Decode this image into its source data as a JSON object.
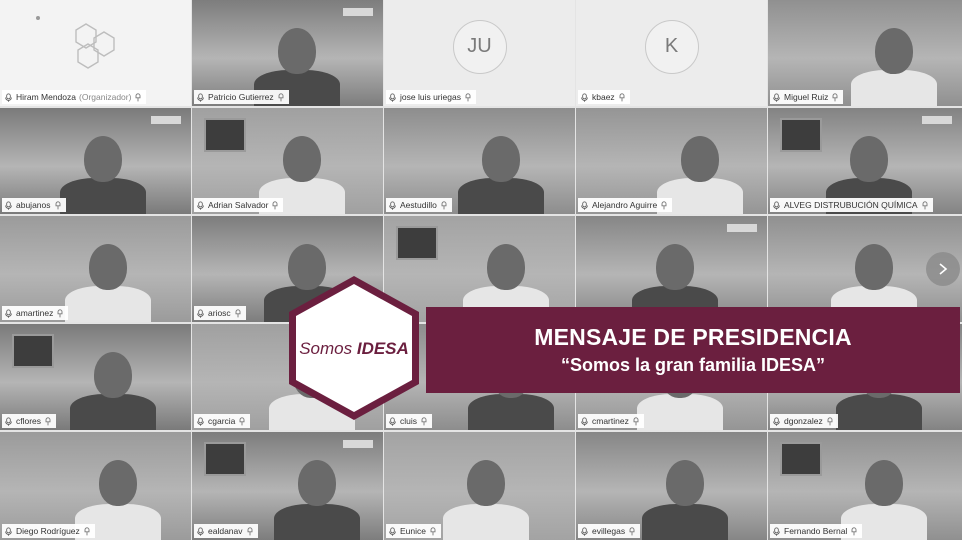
{
  "meeting": {
    "participants": [
      {
        "name": "Hiram Mendoza",
        "role": "(Organizador)",
        "tile": "logo"
      },
      {
        "name": "Patricio Gutierrez",
        "tile": "video"
      },
      {
        "name": "jose luis uriegas",
        "tile": "initials",
        "initials": "JU"
      },
      {
        "name": "kbaez",
        "tile": "initials",
        "initials": "K"
      },
      {
        "name": "Miguel Ruiz",
        "tile": "video"
      },
      {
        "name": "abujanos",
        "tile": "video"
      },
      {
        "name": "Adrian Salvador",
        "tile": "video"
      },
      {
        "name": "Aestudillo",
        "tile": "video"
      },
      {
        "name": "Alejandro Aguirre",
        "tile": "video"
      },
      {
        "name": "ALVEG DISTRUBUCIÓN QUÍMICA",
        "tile": "video"
      },
      {
        "name": "amartinez",
        "tile": "video"
      },
      {
        "name": "ariosc",
        "tile": "video"
      },
      {
        "name": "",
        "tile": "video"
      },
      {
        "name": "",
        "tile": "video"
      },
      {
        "name": "",
        "tile": "video"
      },
      {
        "name": "cflores",
        "tile": "video"
      },
      {
        "name": "cgarcia",
        "tile": "video"
      },
      {
        "name": "cluis",
        "tile": "video"
      },
      {
        "name": "cmartinez",
        "tile": "video"
      },
      {
        "name": "dgonzalez",
        "tile": "video"
      },
      {
        "name": "Diego Rodríguez",
        "tile": "video"
      },
      {
        "name": "ealdanav",
        "tile": "video"
      },
      {
        "name": "Eunice",
        "tile": "video"
      },
      {
        "name": "evillegas",
        "tile": "video"
      },
      {
        "name": "Fernando Bernal",
        "tile": "video"
      }
    ]
  },
  "overlay": {
    "title": "MENSAJE DE PRESIDENCIA",
    "subtitle": "“Somos la gran familia IDESA”",
    "logo_text_plain": "Somos",
    "logo_text_bold": "IDESA",
    "brand_color": "#6b1f3f"
  },
  "icons": {
    "mic": "microphone-icon",
    "pin": "pin-icon",
    "next": "chevron-right-icon"
  }
}
